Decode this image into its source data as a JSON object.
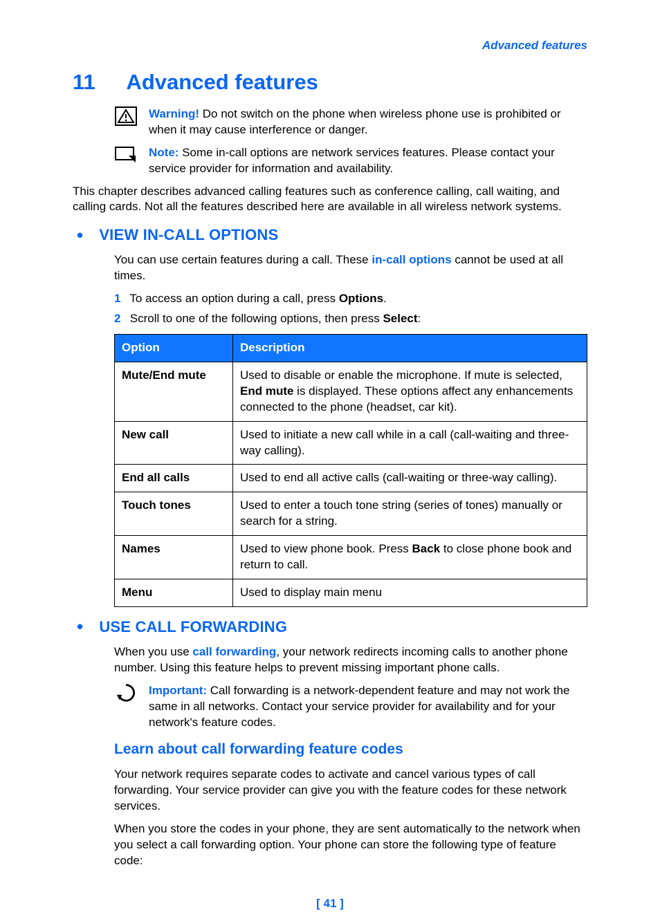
{
  "header": {
    "breadcrumb": "Advanced features"
  },
  "chapter": {
    "number": "11",
    "title": "Advanced features"
  },
  "warning": {
    "label": "Warning!",
    "text": "Do not switch on the phone when wireless phone use is prohibited or when it may cause interference or danger."
  },
  "note": {
    "label": "Note:",
    "text": "Some in-call options are network services features. Please contact your service provider for information and availability."
  },
  "intro": "This chapter describes advanced calling features such as conference calling, call waiting, and calling cards. Not all the features described here are available in all wireless network systems.",
  "section1": {
    "title": "VIEW IN-CALL OPTIONS",
    "intro_pre": "You can use certain features during a call. These ",
    "intro_link": "in-call options",
    "intro_post": " cannot be used at all times.",
    "step1_num": "1",
    "step1_pre": "To access an option during a call, press ",
    "step1_bold": "Options",
    "step1_post": ".",
    "step2_num": "2",
    "step2_pre": "Scroll to one of the following options, then press ",
    "step2_bold": "Select",
    "step2_post": ":"
  },
  "table": {
    "head_opt": "Option",
    "head_desc": "Description",
    "r1_opt": "Mute/End mute",
    "r1_desc_pre": "Used to disable or enable the microphone. If mute is selected, ",
    "r1_desc_b1": "End mute",
    "r1_desc_post": " is displayed. These options affect any enhancements connected to the phone (headset, car kit).",
    "r2_opt": "New call",
    "r2_desc": "Used to initiate a new call while in a call (call-waiting and three-way calling).",
    "r3_opt": "End all calls",
    "r3_desc": "Used to end all active calls (call-waiting or three-way calling).",
    "r4_opt": "Touch tones",
    "r4_desc": "Used to enter a touch tone string (series of tones) manually or search for a string.",
    "r5_opt": "Names",
    "r5_desc_pre": "Used to view phone book. Press ",
    "r5_desc_b": "Back",
    "r5_desc_post": " to close phone book and return to call.",
    "r6_opt": "Menu",
    "r6_desc": "Used to display main menu"
  },
  "section2": {
    "title": "USE CALL FORWARDING",
    "intro_pre": "When you use ",
    "intro_link": "call forwarding",
    "intro_post": ", your network redirects incoming calls to another phone number. Using this feature helps to prevent missing important phone calls.",
    "important_label": "Important:",
    "important_text": "Call forwarding is a network-dependent feature and may not work the same in all networks. Contact your service provider for availability and for your network's feature codes.",
    "sub_title": "Learn about call forwarding feature codes",
    "para1": "Your network requires separate codes to activate and cancel various types of call forwarding. Your service provider can give you with the feature codes for these network services.",
    "para2": "When you store the codes in your phone, they are sent automatically to the network when you select a call forwarding option. Your phone can store the following type of feature code:"
  },
  "footer": {
    "page": "[ 41 ]"
  }
}
